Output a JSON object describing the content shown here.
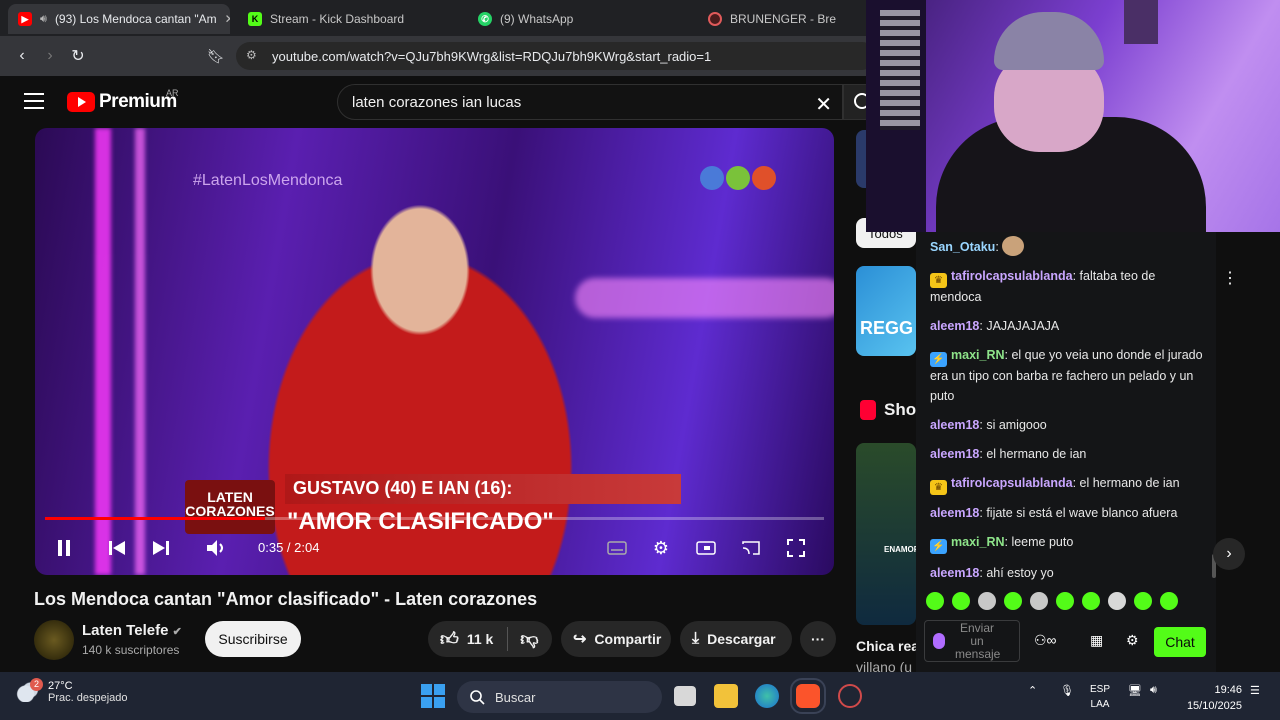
{
  "browser": {
    "tabs": [
      {
        "title": "(93) Los Mendoca cantan \"Am",
        "icon": "youtube-icon",
        "active": true
      },
      {
        "title": "Stream - Kick Dashboard",
        "icon": "kick-icon",
        "active": false
      },
      {
        "title": "(9) WhatsApp",
        "icon": "whatsapp-icon",
        "active": false
      },
      {
        "title": "BRUNENGER - Bre",
        "icon": "recording-icon",
        "active": false
      }
    ],
    "tab_close": "✕",
    "url": "youtube.com/watch?v=QJu7bh9KWrg&list=RDQJu7bh9KWrg&start_radio=1"
  },
  "youtube": {
    "logo_text": "Premium",
    "region": "AR",
    "search_value": "laten corazones ian lucas",
    "search_clear": "✕",
    "player": {
      "overlay_hashtag": "#LatenLosMendonca",
      "lower_third_logo": "LATEN CORAZONES",
      "lower_third_line1": "GUSTAVO (40) E IAN (16):",
      "lower_third_line2": "\"AMOR CLASIFICADO\"",
      "time": "0:35 / 2:04",
      "progress": 0.282
    },
    "video_title": "Los Mendoca cantan \"Amor clasificado\" - Laten corazones",
    "channel": {
      "name": "Laten Telefe",
      "subscribers": "140 k suscriptores",
      "subscribe_label": "Suscribirse"
    },
    "actions": {
      "likes": "11 k",
      "share": "Compartir",
      "download": "Descargar",
      "more": "···"
    },
    "sidebar": {
      "chip_all": "Todos",
      "shorts_label": "Sho",
      "thumb_text": "REGG",
      "short_thumb_text": "ENAMOR",
      "suggestion_title_1": "Chica rea",
      "suggestion_title_2": "villano (u"
    }
  },
  "webcam": {
    "note": ""
  },
  "chat": {
    "messages": [
      {
        "user": "San_Otaku",
        "color": "#9ad6ff",
        "badge": "",
        "text": "",
        "emote": true
      },
      {
        "user": "tafirolcapsulablanda",
        "color": "#c9a6ff",
        "badge": "crown",
        "text": "faltaba teo de mendoca"
      },
      {
        "user": "aleem18",
        "color": "#c9a6ff",
        "badge": "",
        "text": "JAJAJAJAJA"
      },
      {
        "user": "maxi_RN",
        "color": "#8ee48a",
        "badge": "bolt",
        "text": "el que yo veia uno donde el jurado era un tipo con barba re fachero un pelado y un puto"
      },
      {
        "user": "aleem18",
        "color": "#c9a6ff",
        "badge": "",
        "text": "si amigooo"
      },
      {
        "user": "aleem18",
        "color": "#c9a6ff",
        "badge": "",
        "text": "el hermano de ian"
      },
      {
        "user": "tafirolcapsulablanda",
        "color": "#c9a6ff",
        "badge": "crown",
        "text": "el hermano de ian"
      },
      {
        "user": "aleem18",
        "color": "#c9a6ff",
        "badge": "",
        "text": "fijate si está el wave blanco afuera"
      },
      {
        "user": "maxi_RN",
        "color": "#8ee48a",
        "badge": "bolt",
        "text": "leeme puto"
      },
      {
        "user": "aleem18",
        "color": "#c9a6ff",
        "badge": "",
        "text": "ahí estoy yo"
      }
    ],
    "input_placeholder": "Enviar un mensaje",
    "send_label": "Chat",
    "accent": "#53fc18"
  },
  "taskbar": {
    "temperature": "27°C",
    "weather_desc": "Prac. despejado",
    "weather_badge": "2",
    "search_placeholder": "Buscar",
    "lang_1": "ESP",
    "lang_2": "LAA",
    "time": "19:46",
    "date": "15/10/2025"
  }
}
